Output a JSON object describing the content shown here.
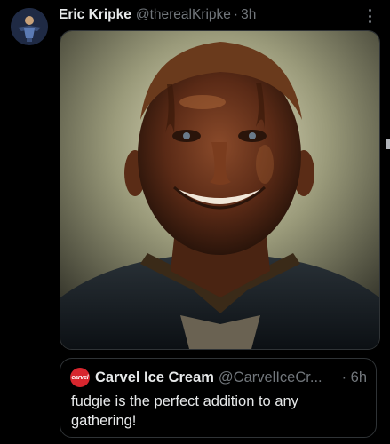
{
  "tweet": {
    "author_name": "Eric Kripke",
    "author_handle": "@therealKripke",
    "separator": "·",
    "time": "3h",
    "more_icon": "more-vertical-icon"
  },
  "quote": {
    "avatar_text": "carvel",
    "author_name": "Carvel Ice Cream",
    "author_handle": "@CarvelIceCr...",
    "time": "· 6h",
    "text": "fudgie is the perfect addition to any gathering!"
  },
  "colors": {
    "background": "#000000",
    "text_primary": "#e7e9ea",
    "text_secondary": "#71767b",
    "border": "#2f3336",
    "carvel_red": "#d7262e"
  }
}
